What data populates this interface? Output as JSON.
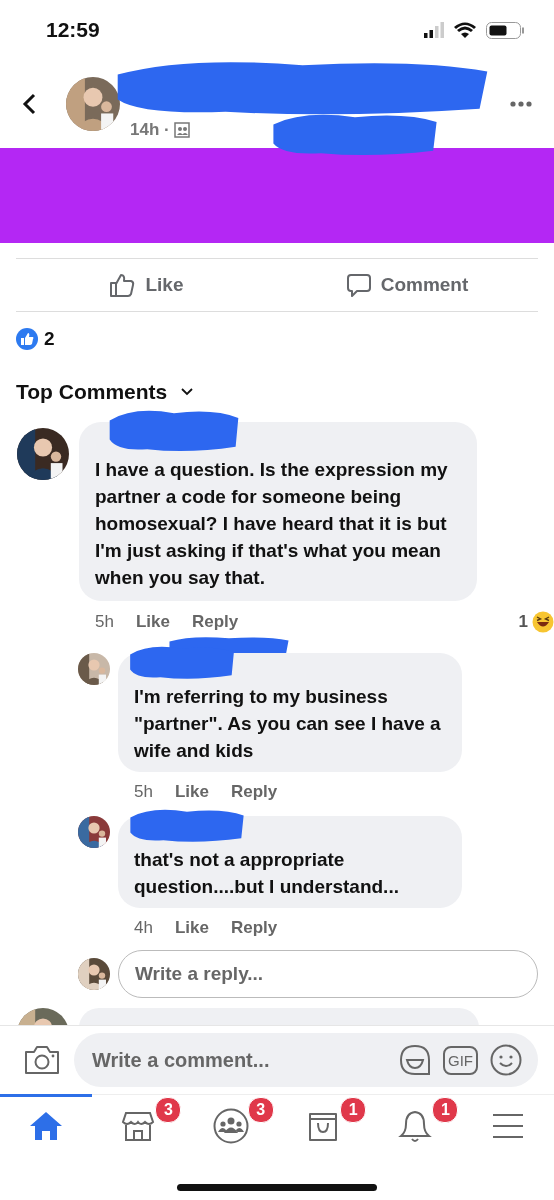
{
  "status_bar": {
    "time": "12:59"
  },
  "post_header": {
    "time": "14h ·"
  },
  "actions": [
    {
      "kind": "like",
      "label": "Like"
    },
    {
      "kind": "comment",
      "label": "Comment"
    }
  ],
  "reactions": {
    "count": "2"
  },
  "comments_heading": "Top Comments",
  "comments": [
    {
      "text": "I have a question. Is the expression my partner a code for someone being homosexual? I have heard that it is but I'm just asking if that's what you mean when you say that.",
      "time": "5h",
      "like": "Like",
      "reply": "Reply",
      "reaction_count": "1",
      "replies": [
        {
          "text": "I'm referring to my business \"partner\". As you can see I have a wife and kids",
          "time": "5h",
          "like": "Like",
          "reply": "Reply"
        },
        {
          "text": "that's not a appropriate question....but I understand...",
          "time": "4h",
          "like": "Like",
          "reply": "Reply"
        }
      ]
    }
  ],
  "reply_field": {
    "placeholder": "Write a reply..."
  },
  "composer": {
    "placeholder": "Write a comment...",
    "gif": "GIF"
  },
  "nav": [
    {
      "kind": "home",
      "selected": true
    },
    {
      "kind": "shop",
      "badge": "3",
      "selected": false
    },
    {
      "kind": "groups",
      "badge": "3",
      "selected": false
    },
    {
      "kind": "bag",
      "badge": "1",
      "selected": false
    },
    {
      "kind": "bell",
      "badge": "1",
      "selected": false
    },
    {
      "kind": "menu",
      "selected": false
    }
  ]
}
